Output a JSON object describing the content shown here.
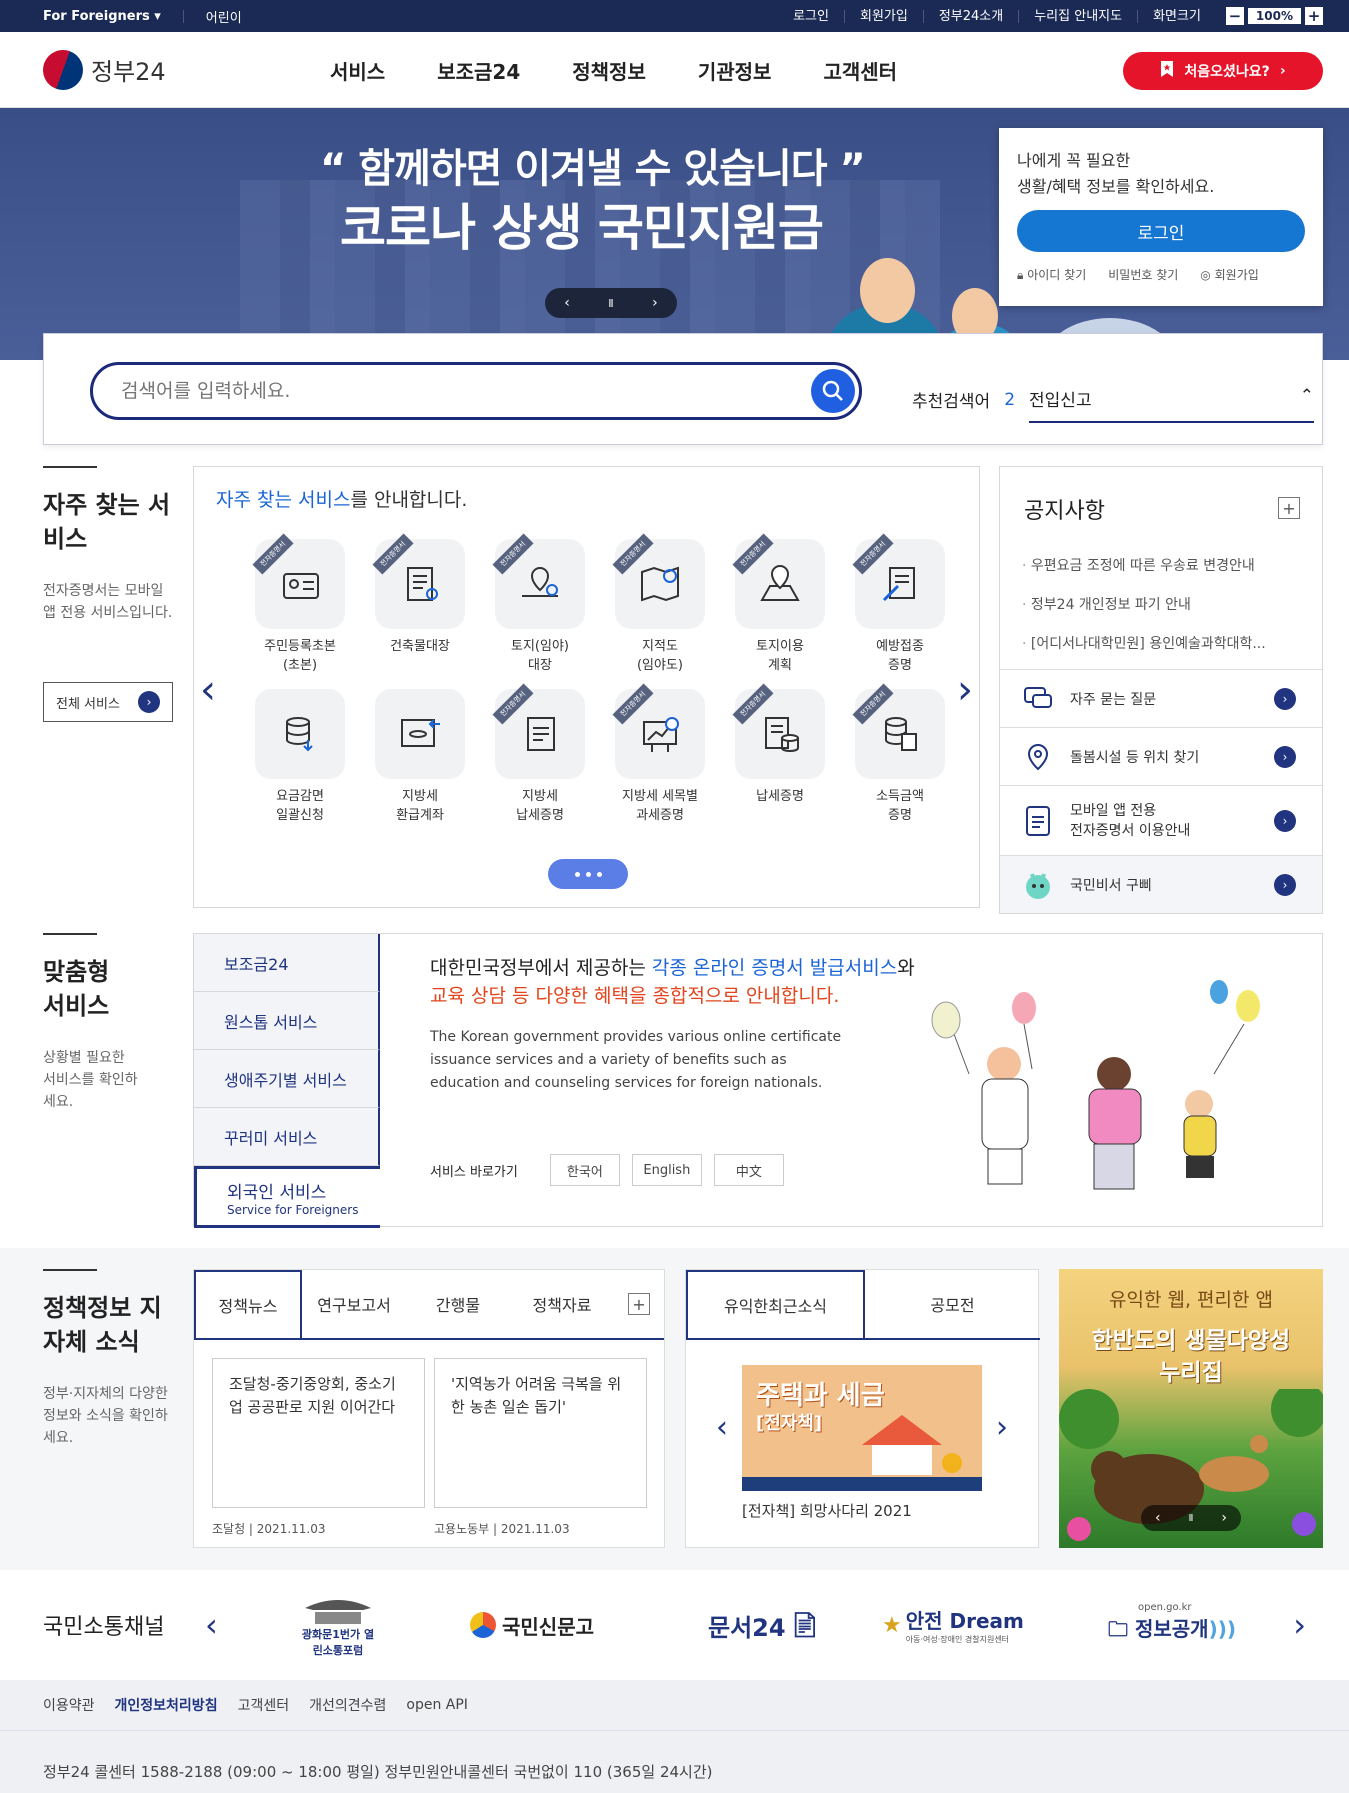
{
  "topbar": {
    "foreigners": "For Foreigners ▾",
    "kids": "어린이",
    "login": "로그인",
    "join": "회원가입",
    "intro": "정부24소개",
    "guide": "누리집 안내지도",
    "zoom_label": "화면크기",
    "zoom_minus": "−",
    "zoom_value": "100%",
    "zoom_plus": "+"
  },
  "header": {
    "logo": "정부24",
    "nav": [
      "서비스",
      "보조금24",
      "정책정보",
      "기관정보",
      "고객센터"
    ],
    "first_visit": "처음오셨나요?"
  },
  "hero": {
    "quote": "“ 함께하면 이겨낼 수 있습니다 ”",
    "title": "코로나 상생 국민지원금",
    "ctrl_prev": "‹",
    "ctrl_pause": "Ⅱ",
    "ctrl_next": "›"
  },
  "loginbox": {
    "line1": "나에게 꼭 필요한",
    "line2": "생활/혜택 정보를 확인하세요.",
    "login": "로그인",
    "find_id": "아이디 찾기",
    "find_pw": "비밀번호 찾기",
    "join": "회원가입"
  },
  "search": {
    "placeholder": "검색어를 입력하세요.",
    "rec_label": "추천검색어",
    "rec_num": "2",
    "rec_kw": "전입신고"
  },
  "frequent": {
    "title": "자주 찾는 서비스",
    "desc": "전자증명서는 모바일 앱 전용 서비스입니다.",
    "all_btn": "전체 서비스",
    "panel_title_em": "자주 찾는 서비스",
    "panel_title_rest": "를 안내합니다.",
    "ribbon": "전자증명서",
    "items": [
      {
        "label": "주민등록초본\n(초본)",
        "icon": "id-card-icon"
      },
      {
        "label": "건축물대장",
        "icon": "building-doc-icon"
      },
      {
        "label": "토지(임야)\n대장",
        "icon": "land-map-icon"
      },
      {
        "label": "지적도\n(임야도)",
        "icon": "cadastral-map-icon"
      },
      {
        "label": "토지이용\n계획",
        "icon": "land-use-icon"
      },
      {
        "label": "예방접종\n증명",
        "icon": "vaccine-icon"
      },
      {
        "label": "요금감면\n일괄신청",
        "icon": "fee-reduction-icon"
      },
      {
        "label": "지방세\n환급계좌",
        "icon": "tax-refund-icon"
      },
      {
        "label": "지방세\n납세증명",
        "icon": "tax-cert-icon"
      },
      {
        "label": "지방세 세목별\n과세증명",
        "icon": "tax-chart-icon"
      },
      {
        "label": "납세증명",
        "icon": "tax-payment-icon"
      },
      {
        "label": "소득금액\n증명",
        "icon": "income-cert-icon"
      }
    ]
  },
  "notice": {
    "title": "공지사항",
    "items": [
      "우편요금 조정에 따른 우송료 변경안내",
      "정부24 개인정보 파기 안내",
      "[어디서나대학민원] 용인예술과학대학..."
    ],
    "quick": [
      {
        "label": "자주 묻는 질문",
        "icon": "faq-icon"
      },
      {
        "label": "돌봄시설 등 위치 찾기",
        "icon": "location-icon"
      },
      {
        "label1": "모바일 앱 전용",
        "label2": "전자증명서 이용안내",
        "icon": "mobile-cert-icon"
      },
      {
        "label": "국민비서 구삐",
        "icon": "gubbi-icon"
      }
    ]
  },
  "custom": {
    "title": "맞춤형 서비스",
    "desc": "상황별 필요한 서비스를 확인하세요.",
    "tabs": [
      "보조금24",
      "원스톱 서비스",
      "생애주기별 서비스",
      "꾸러미 서비스"
    ],
    "active_tab": "외국인 서비스",
    "active_sub": "Service for Foreigners",
    "line1_a": "대한민국정부에서 제공하는 ",
    "line1_b": "각종 온라인 증명서 발급서비스",
    "line1_c": "와",
    "line2": "교육 상담 등 다양한 혜택을 종합적으로 안내합니다.",
    "english": "The Korean government provides various online certificate issuance services and a variety of benefits such as education and counseling services for foreign nationals.",
    "shortcut_label": "서비스 바로가기",
    "langs": [
      "한국어",
      "English",
      "中文"
    ]
  },
  "policy": {
    "title": "정책정보 지자체 소식",
    "desc": "정부·지자체의 다양한 정보와 소식을 확인하세요.",
    "tabs": [
      "정책뉴스",
      "연구보고서",
      "간행물",
      "정책자료"
    ],
    "cards": [
      {
        "text": "조달청-중기중앙회, 중소기업 공공판로 지원 이어간다",
        "date": "조달청 | 2021.11.03"
      },
      {
        "text": "'지역농가 어려움 극복을 위한 농촌 일손 돕기'",
        "date": "고용노동부 | 2021.11.03"
      }
    ]
  },
  "news": {
    "tabs": [
      "유익한최근소식",
      "공모전"
    ],
    "thumb_title": "주택과 세금",
    "thumb_sub": "[전자책]",
    "caption": "[전자책] 희망사다리 2021"
  },
  "banner": {
    "line1": "유익한 웹, 편리한 앱",
    "line2": "한반도의 생물다양성",
    "line3": "누리집",
    "pause": "Ⅱ"
  },
  "channel": {
    "title": "국민소통채널",
    "logos": [
      "광화문1번가 열린소통포럼",
      "국민신문고",
      "문서24",
      "안전 Dream",
      "정보공개"
    ],
    "logo_sub": "아동·여성·장애인 경찰지원센터",
    "open_site": "open.go.kr"
  },
  "footer": {
    "links": [
      "이용약관",
      "개인정보처리방침",
      "고객센터",
      "개선의견수렴",
      "open API"
    ],
    "callcenter": "정부24 콜센터 1588-2188 (09:00 ~ 18:00 평일)   정부민원안내콜센터 국번없이 110 (365일 24시간)"
  },
  "colors": {
    "navy": "#1b2a55",
    "accent_blue": "#1a64d8",
    "red": "#e5142a",
    "orange": "#e3441b"
  }
}
